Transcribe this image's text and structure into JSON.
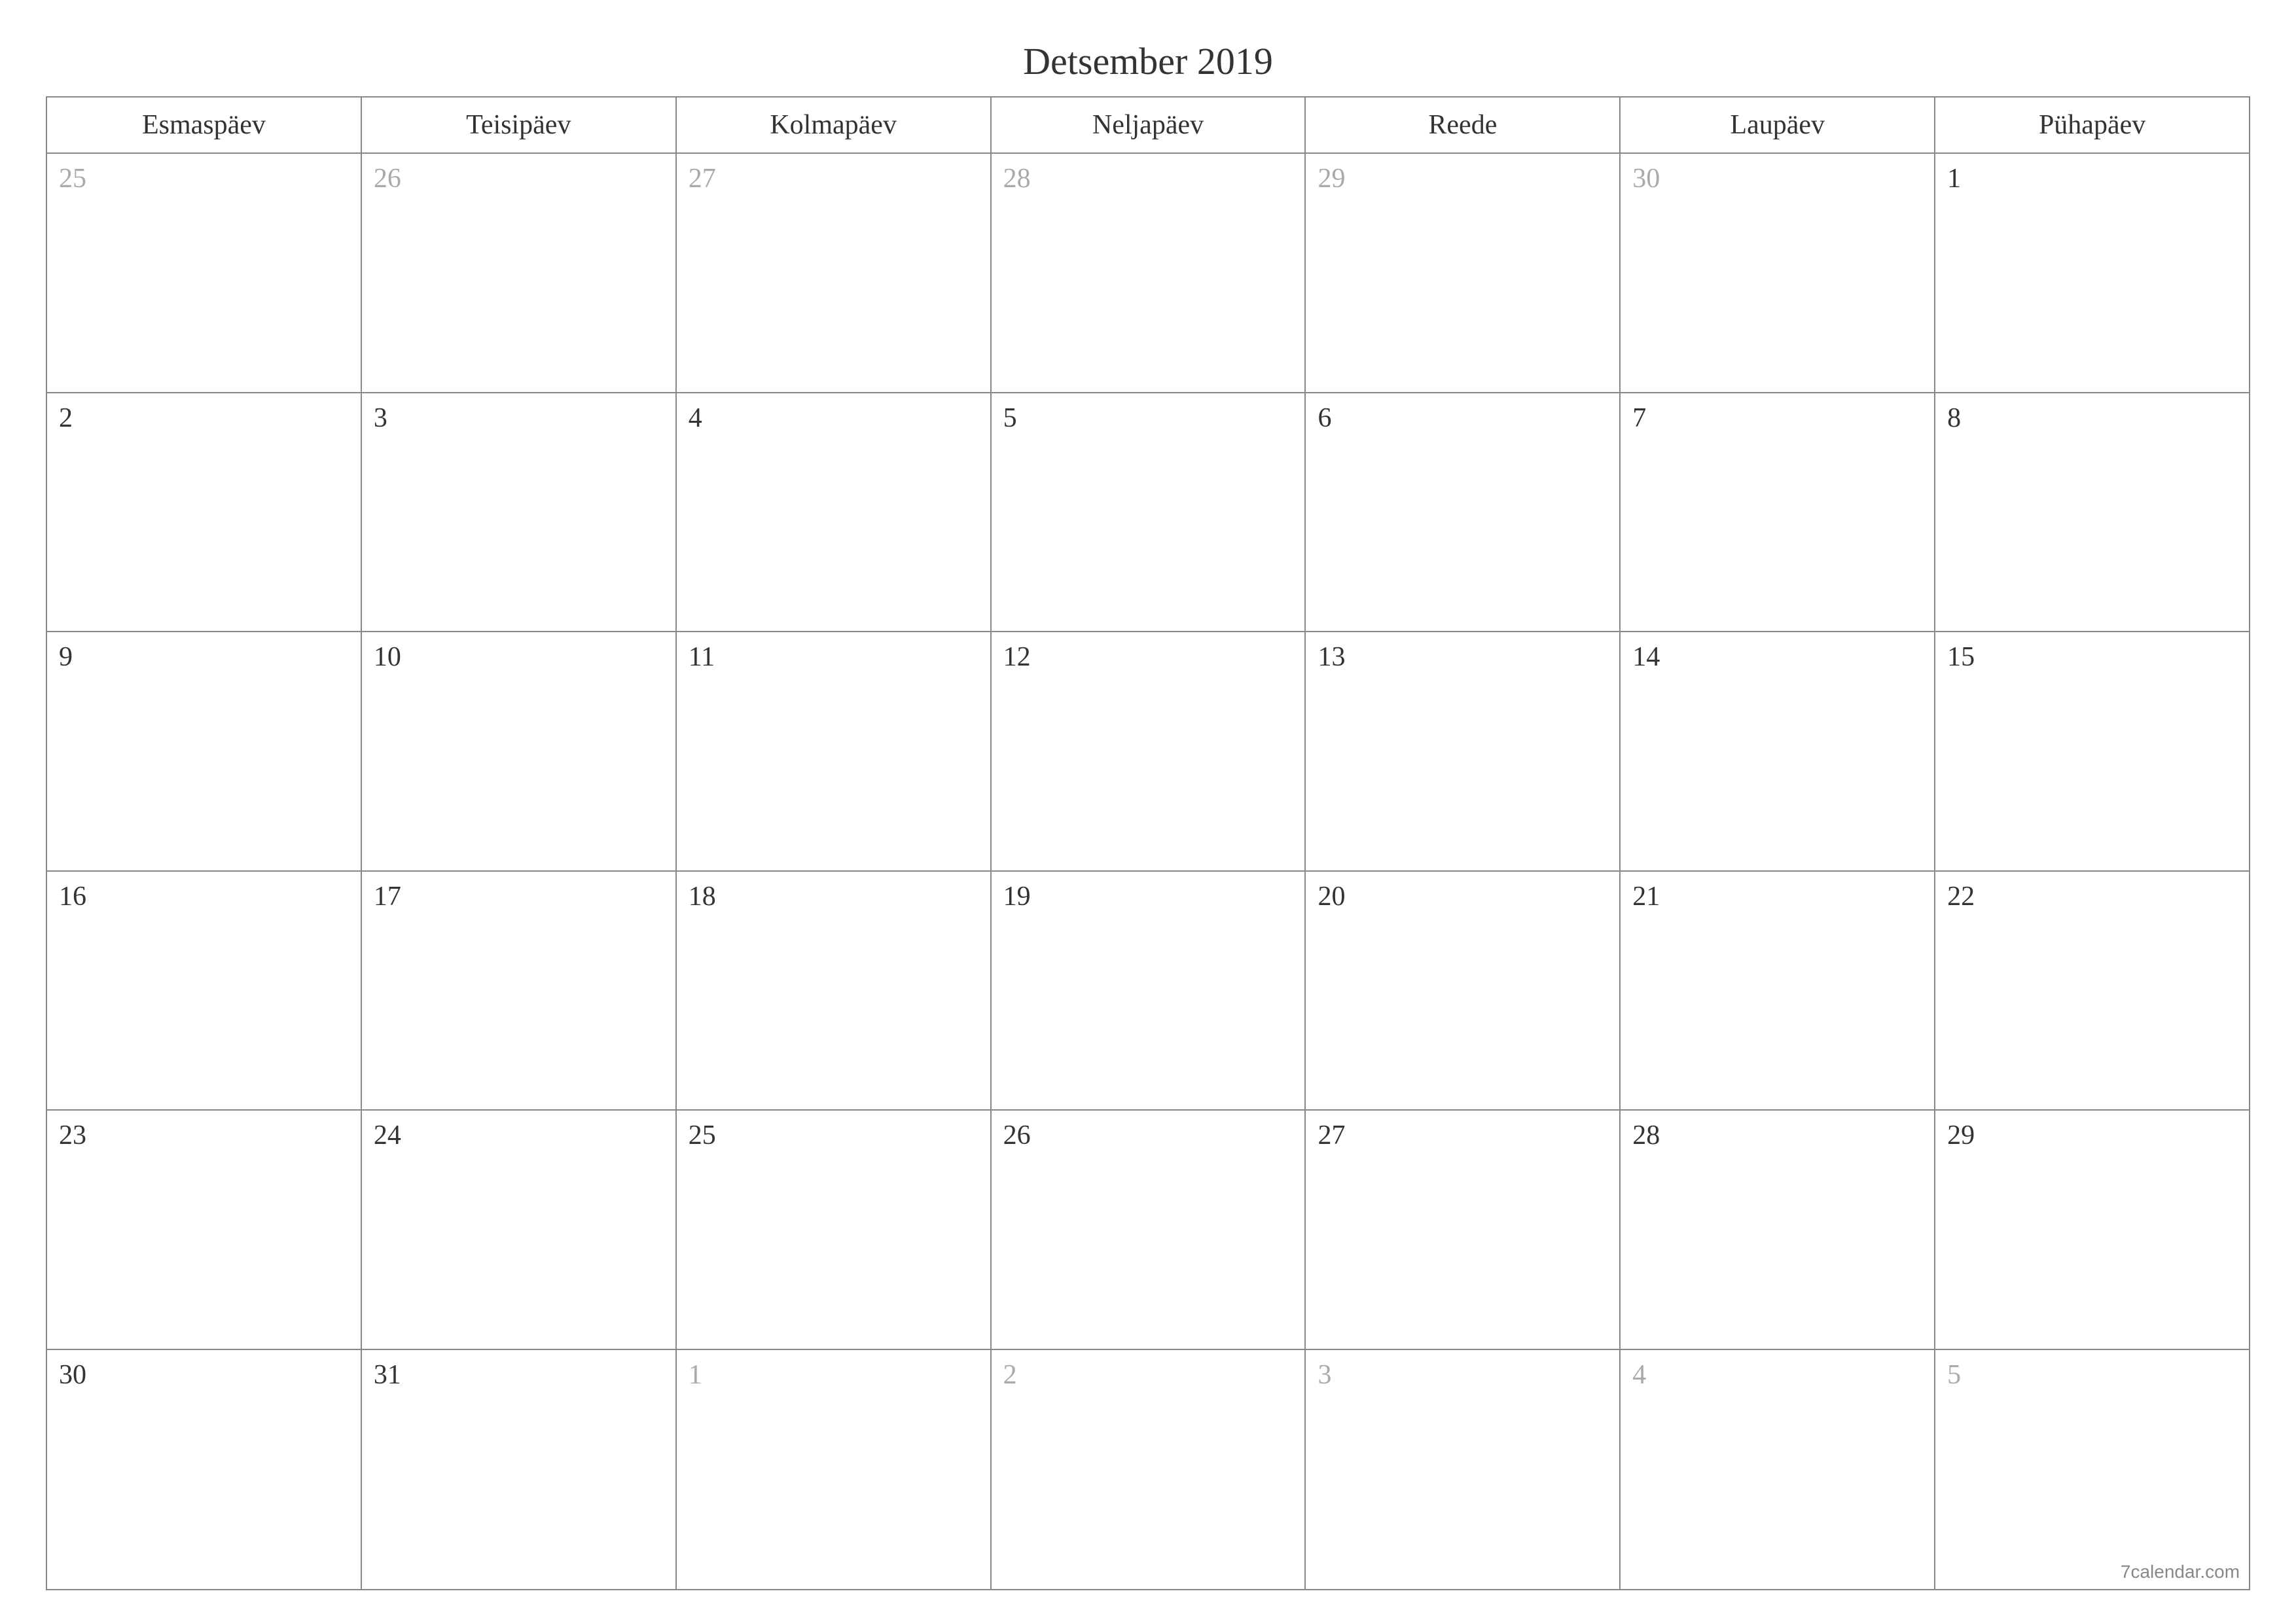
{
  "title": "Detsember 2019",
  "weekdays": [
    "Esmaspäev",
    "Teisipäev",
    "Kolmapäev",
    "Neljapäev",
    "Reede",
    "Laupäev",
    "Pühapäev"
  ],
  "weeks": [
    [
      {
        "day": "25",
        "other": true
      },
      {
        "day": "26",
        "other": true
      },
      {
        "day": "27",
        "other": true
      },
      {
        "day": "28",
        "other": true
      },
      {
        "day": "29",
        "other": true
      },
      {
        "day": "30",
        "other": true
      },
      {
        "day": "1",
        "other": false
      }
    ],
    [
      {
        "day": "2",
        "other": false
      },
      {
        "day": "3",
        "other": false
      },
      {
        "day": "4",
        "other": false
      },
      {
        "day": "5",
        "other": false
      },
      {
        "day": "6",
        "other": false
      },
      {
        "day": "7",
        "other": false
      },
      {
        "day": "8",
        "other": false
      }
    ],
    [
      {
        "day": "9",
        "other": false
      },
      {
        "day": "10",
        "other": false
      },
      {
        "day": "11",
        "other": false
      },
      {
        "day": "12",
        "other": false
      },
      {
        "day": "13",
        "other": false
      },
      {
        "day": "14",
        "other": false
      },
      {
        "day": "15",
        "other": false
      }
    ],
    [
      {
        "day": "16",
        "other": false
      },
      {
        "day": "17",
        "other": false
      },
      {
        "day": "18",
        "other": false
      },
      {
        "day": "19",
        "other": false
      },
      {
        "day": "20",
        "other": false
      },
      {
        "day": "21",
        "other": false
      },
      {
        "day": "22",
        "other": false
      }
    ],
    [
      {
        "day": "23",
        "other": false
      },
      {
        "day": "24",
        "other": false
      },
      {
        "day": "25",
        "other": false
      },
      {
        "day": "26",
        "other": false
      },
      {
        "day": "27",
        "other": false
      },
      {
        "day": "28",
        "other": false
      },
      {
        "day": "29",
        "other": false
      }
    ],
    [
      {
        "day": "30",
        "other": false
      },
      {
        "day": "31",
        "other": false
      },
      {
        "day": "1",
        "other": true
      },
      {
        "day": "2",
        "other": true
      },
      {
        "day": "3",
        "other": true
      },
      {
        "day": "4",
        "other": true
      },
      {
        "day": "5",
        "other": true
      }
    ]
  ],
  "footer": "7calendar.com"
}
